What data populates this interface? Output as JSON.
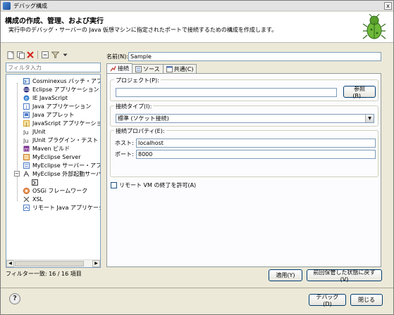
{
  "window": {
    "title": "デバッグ構成",
    "close_glyph": "x"
  },
  "header": {
    "title": "構成の作成、管理、および実行",
    "description": "実行中のデバッグ・サーバーの Java 仮想マシンに指定されたポートで接続するための構成を作成します。",
    "icon": "bug-icon"
  },
  "left": {
    "filter_placeholder": "フィルタ入力",
    "tree": [
      {
        "label": "Cosminexus バッチ・アプリケーシ",
        "icon": "batch-icon",
        "color": "#3b6fb6"
      },
      {
        "label": "Eclipse アプリケーション",
        "icon": "eclipse-icon",
        "color": "#2c2f7d"
      },
      {
        "label": "IE JavaScript",
        "icon": "ie-icon",
        "color": "#2f7fd1"
      },
      {
        "label": "Java アプリケーション",
        "icon": "java-app-icon",
        "color": "#4b7ac7"
      },
      {
        "label": "Java アプレット",
        "icon": "java-applet-icon",
        "color": "#4b7ac7"
      },
      {
        "label": "JavaScript アプリケーション",
        "icon": "js-icon",
        "color": "#d9a52b"
      },
      {
        "label": "JUnit",
        "icon": "junit-icon",
        "color": "#333333"
      },
      {
        "label": "JUnit プラグイン・テスト",
        "icon": "junit-plugin-icon",
        "color": "#333333"
      },
      {
        "label": "Maven ビルド",
        "icon": "maven-icon",
        "color": "#7a2f8e"
      },
      {
        "label": "MyEclipse Server",
        "icon": "myeclipse-server-icon",
        "color": "#c97c1c"
      },
      {
        "label": "MyEclipse サーバー・アプリケー",
        "icon": "myeclipse-app-icon",
        "color": "#4b7ac7"
      },
      {
        "label": "MyEclipse 外部起動サーバー",
        "icon": "myeclipse-external-icon",
        "color": "#444444"
      },
      {
        "label": "",
        "icon": "config-icon",
        "color": "#444444"
      },
      {
        "label": "OSGi フレームワーク",
        "icon": "osgi-icon",
        "color": "#c0541c"
      },
      {
        "label": "XSL",
        "icon": "xsl-icon",
        "color": "#555555"
      },
      {
        "label": "リモート Java アプリケーション",
        "icon": "remote-java-icon",
        "color": "#4b7ac7"
      }
    ],
    "filter_status": "フィルター一致: 16 / 16 項目"
  },
  "right": {
    "name_label": "名前(N):",
    "name_value": "Sample",
    "tabs": [
      {
        "label": "接続",
        "icon": "connect-icon"
      },
      {
        "label": "ソース",
        "icon": "source-icon"
      },
      {
        "label": "共通(C)",
        "icon": "common-icon"
      }
    ],
    "project": {
      "legend": "プロジェクト(P):",
      "value": "",
      "browse_label": "参照(B)..."
    },
    "connection_type": {
      "legend": "接続タイプ(I):",
      "selected": "標準 (ソケット接続)"
    },
    "connection_props": {
      "legend": "接続プロパティ(E):",
      "host_label": "ホスト:",
      "host_value": "localhost",
      "port_label": "ポート:",
      "port_value": "8000"
    },
    "allow_terminate_label": "リモート VM の終了を許可(A)",
    "apply_label": "適用(Y)",
    "revert_label": "前回保管した状態に戻す(V)"
  },
  "footer": {
    "help_glyph": "?",
    "debug_label": "デバッグ(D)",
    "close_label": "閉じる"
  }
}
